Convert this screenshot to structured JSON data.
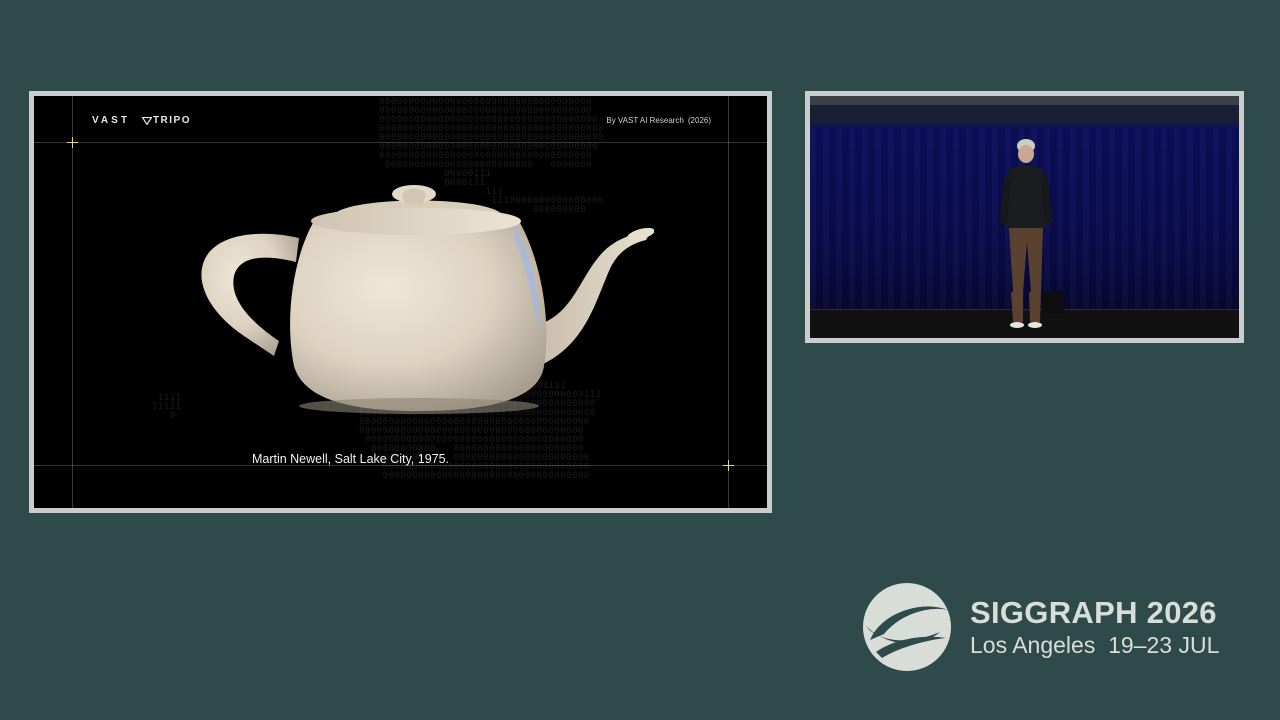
{
  "slide": {
    "brand_primary": "VAST",
    "brand_secondary": "TRIPO",
    "credit_text": "By VAST AI Research",
    "credit_year": "(2026)",
    "caption": "Martin Newell, Salt Lake City, 1975.",
    "accent_color": "#e8d77a"
  },
  "camera": {
    "description_icon": "speaker-on-stage"
  },
  "conference": {
    "name": "SIGGRAPH 2026",
    "city": "Los Angeles",
    "dates": "19–23 JUL"
  }
}
